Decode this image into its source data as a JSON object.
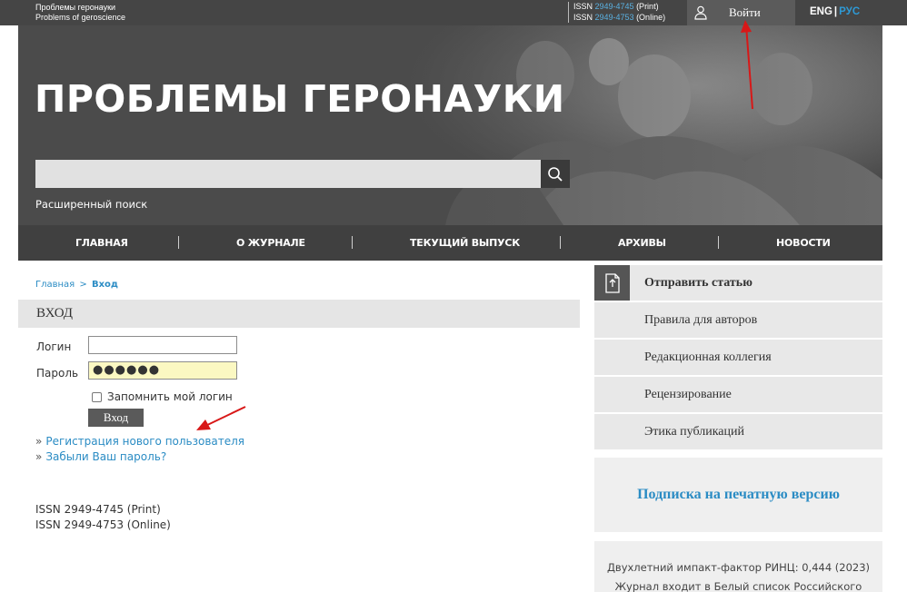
{
  "header": {
    "journal_ru_small": "Проблемы геронауки",
    "journal_en_small": "Problems of geroscience",
    "issn_print_prefix": "ISSN ",
    "issn_print_number": "2949-4745",
    "issn_print_suffix": " (Print)",
    "issn_online_prefix": "ISSN ",
    "issn_online_number": "2949-4753",
    "issn_online_suffix": " (Online)",
    "login_label": "Войти",
    "lang_eng": "ENG",
    "lang_sep": "|",
    "lang_rus": "РУС"
  },
  "banner": {
    "title": "ПРОБЛЕМЫ ГЕРОНАУКИ",
    "search_value": "",
    "advanced_search": "Расширенный поиск"
  },
  "nav": {
    "items": [
      "ГЛАВНАЯ",
      "О ЖУРНАЛЕ",
      "ТЕКУЩИЙ ВЫПУСК",
      "АРХИВЫ",
      "НОВОСТИ"
    ]
  },
  "breadcrumb": {
    "home": "Главная",
    "separator": ">",
    "current": "Вход"
  },
  "login_form": {
    "heading": "ВХОД",
    "username_label": "Логин",
    "username_value": "",
    "password_label": "Пароль",
    "password_value": "●●●●●●",
    "remember_label": "Запомнить мой логин",
    "submit_label": "Вход",
    "link_bullet": "»",
    "register_link": "Регистрация нового пользователя",
    "forgot_link": "Забыли Ваш пароль?"
  },
  "footer_issn": {
    "print": "ISSN 2949-4745 (Print)",
    "online": "ISSN 2949-4753 (Online)"
  },
  "sidebar": {
    "menu": [
      {
        "label": "Отправить статью",
        "icon": "submit-document-icon"
      },
      {
        "label": "Правила для авторов"
      },
      {
        "label": "Редакционная коллегия"
      },
      {
        "label": "Рецензирование"
      },
      {
        "label": "Этика публикаций"
      }
    ],
    "subscribe_link": "Подписка на печатную версию",
    "impact_line1": "Двухлетний импакт-фактор РИНЦ: 0,444 (2023)",
    "impact_line2": "Журнал входит в Белый список Российского"
  },
  "colors": {
    "link_blue": "#2b8cc4",
    "topbar": "#454545",
    "nav": "#404040",
    "annotation_red": "#d81818"
  }
}
